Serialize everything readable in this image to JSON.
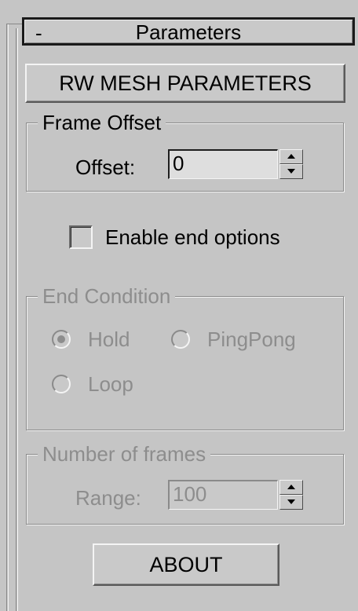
{
  "rollout": {
    "collapse_symbol": "-",
    "title": "Parameters"
  },
  "mesh_button_label": "RW MESH PARAMETERS",
  "frame_offset": {
    "group_title": "Frame Offset",
    "offset_label": "Offset:",
    "offset_value": "0"
  },
  "enable_end_options": {
    "label": "Enable end options",
    "checked": false
  },
  "end_condition": {
    "group_title": "End Condition",
    "enabled": false,
    "options": [
      {
        "label": "Hold",
        "selected": true
      },
      {
        "label": "PingPong",
        "selected": false
      },
      {
        "label": "Loop",
        "selected": false
      }
    ]
  },
  "number_of_frames": {
    "group_title": "Number of frames",
    "range_label": "Range:",
    "range_value": "100",
    "enabled": false
  },
  "about_button_label": "ABOUT",
  "icons": {
    "spinner": "spinner-arrows-icon",
    "collapse": "minus-icon"
  },
  "colors": {
    "panel_bg": "#c5c5c5",
    "disabled_text": "#8d8d8d"
  }
}
